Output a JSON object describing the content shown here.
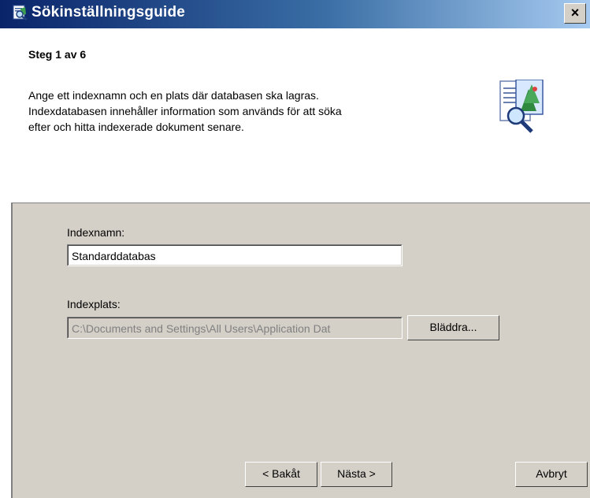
{
  "window": {
    "title": "Sökinställningsguide",
    "close_glyph": "×",
    "title_icon": "search-wizard-icon"
  },
  "header": {
    "step": "Steg 1 av 6",
    "description_lines": [
      "Ange ett indexnamn och en plats där databasen ska lagras.",
      "Indexdatabasen innehåller information som används för att söka",
      "efter och hitta indexerade dokument senare."
    ],
    "image_icon": "document-magnifier-icon"
  },
  "form": {
    "index_name_label": "Indexnamn:",
    "index_name_value": "Standarddatabas",
    "index_location_label": "Indexplats:",
    "index_location_value": "C:\\Documents and Settings\\All Users\\Application Dat",
    "browse_label": "Bläddra..."
  },
  "footer": {
    "back_label": "< Bakåt",
    "next_label": "Nästa >",
    "cancel_label": "Avbryt"
  }
}
